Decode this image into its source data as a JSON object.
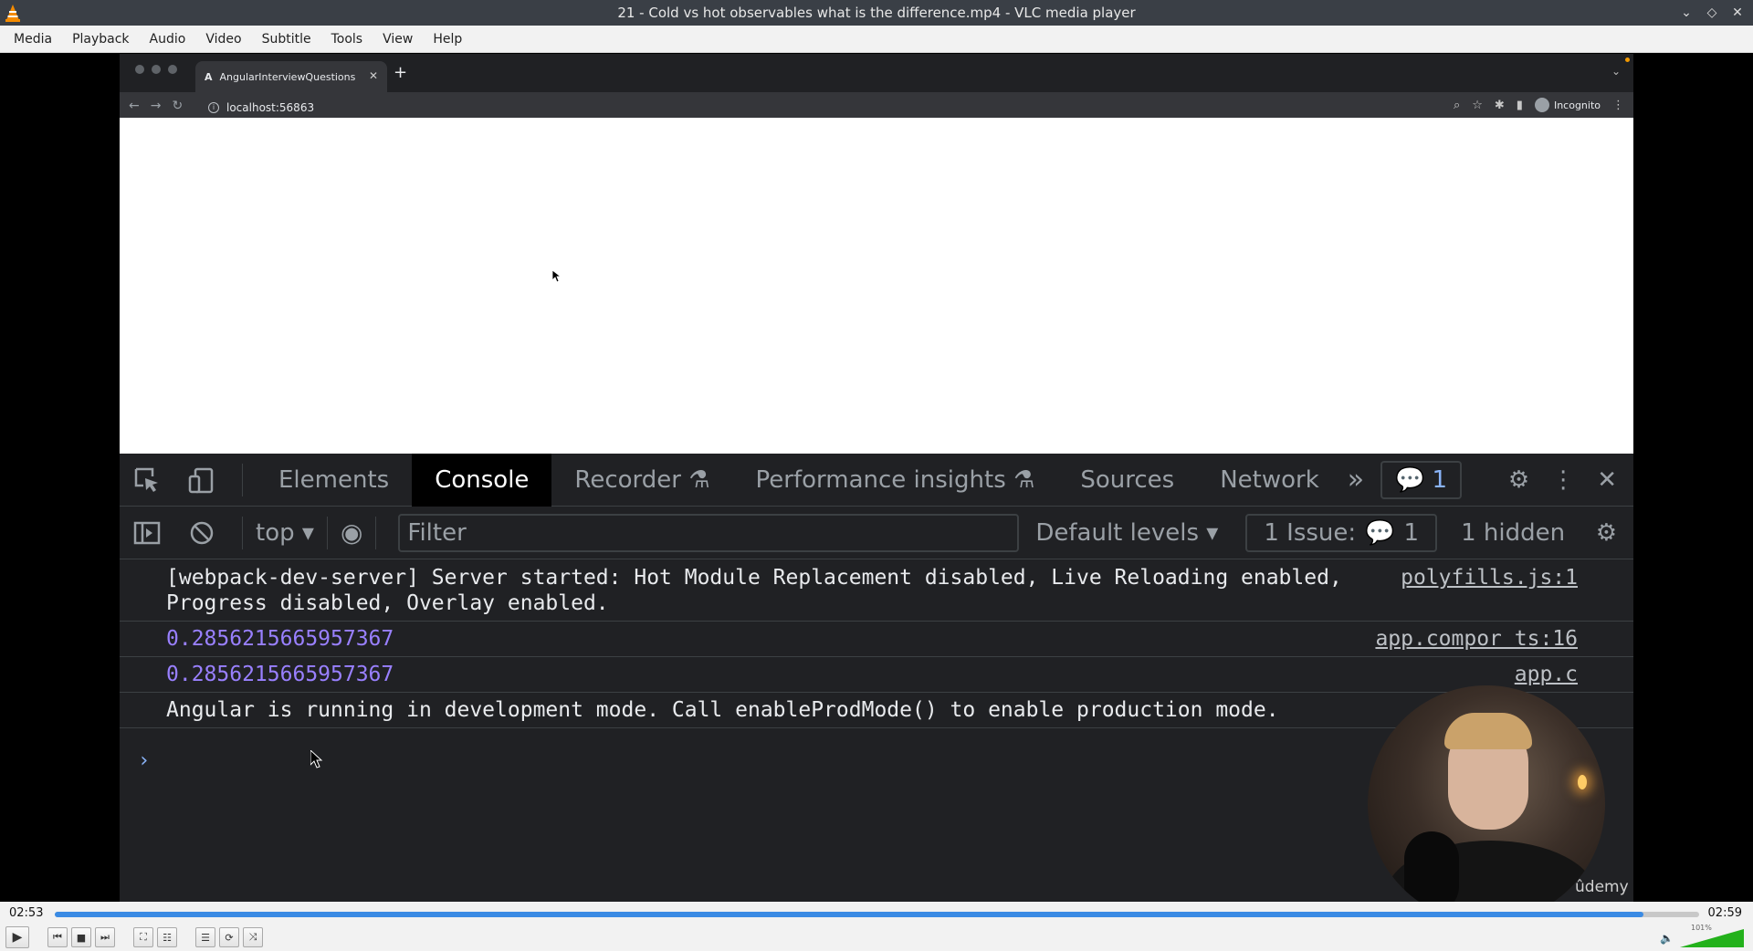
{
  "window": {
    "title": "21 - Cold vs hot observables what is the difference.mp4 - VLC media player",
    "controls": [
      "⌄",
      "◇",
      "✕"
    ]
  },
  "menubar": {
    "items": [
      "Media",
      "Playback",
      "Audio",
      "Video",
      "Subtitle",
      "Tools",
      "View",
      "Help"
    ]
  },
  "browser": {
    "tab_label": "AngularInterviewQuestions",
    "tab_favicon": "A",
    "url": "localhost:56863",
    "incognito_label": "Incognito"
  },
  "devtools": {
    "tabs": [
      "Elements",
      "Console",
      "Recorder",
      "Performance insights",
      "Sources",
      "Network"
    ],
    "active_tab": "Console",
    "overflow": "»",
    "issues_badge": "1",
    "context": "top",
    "filter_placeholder": "Filter",
    "levels": "Default levels",
    "issue_label": "1 Issue:",
    "issue_count": "1",
    "hidden": "1 hidden",
    "messages": [
      {
        "text": "[webpack-dev-server] Server started: Hot Module Replacement disabled, Live Reloading enabled, Progress disabled, Overlay enabled.",
        "source": "polyfills.js:1",
        "kind": "log"
      },
      {
        "text": "0.2856215665957367",
        "source": "app.compor   ts:16",
        "kind": "number"
      },
      {
        "text": "0.2856215665957367",
        "source": "app.c",
        "kind": "number"
      },
      {
        "text": "Angular is running in development mode. Call enableProdMode() to enable production mode.",
        "source": "",
        "kind": "log"
      }
    ],
    "prompt": "›"
  },
  "watermark": "ûdemy",
  "player": {
    "elapsed": "02:53",
    "duration": "02:59",
    "progress": 0.966,
    "volume_percent": "101%",
    "volume_level": 1.01
  },
  "colors": {
    "progress": "#3b8be4",
    "console_number": "#9980ff",
    "link_blue": "#8ab4f8"
  }
}
